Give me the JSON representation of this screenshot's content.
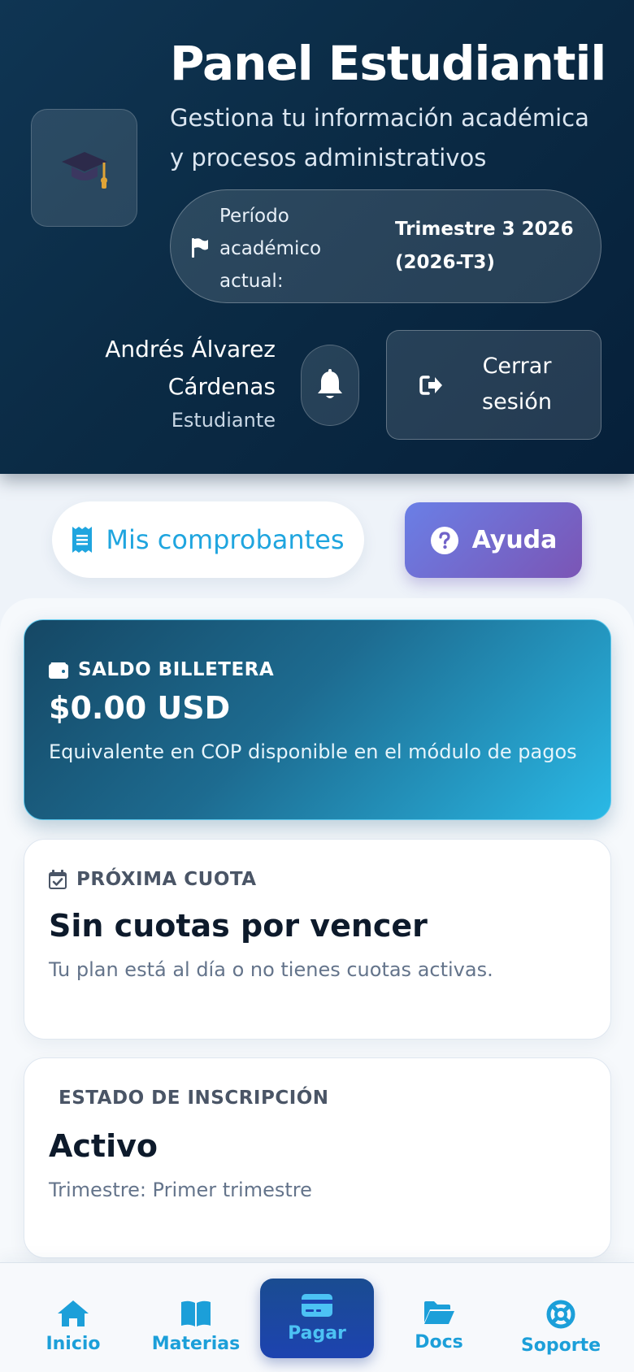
{
  "header": {
    "title": "Panel Estudiantil",
    "subtitle": "Gestiona tu información académica y procesos administrativos",
    "period_label": "Período académico actual:",
    "period_value": "Trimestre 3 2026 (2026-T3)",
    "user_name": "Andrés Álvarez Cárdenas",
    "user_role": "Estudiante",
    "logout_label": "Cerrar sesión"
  },
  "actions": {
    "receipts_label": "Mis comprobantes",
    "help_label": "Ayuda"
  },
  "wallet": {
    "label": "SALDO BILLETERA",
    "amount": "$0.00 USD",
    "note": "Equivalente en COP disponible en el módulo de pagos"
  },
  "next_quota": {
    "label": "PRÓXIMA CUOTA",
    "title": "Sin cuotas por vencer",
    "text": "Tu plan está al día o no tienes cuotas activas."
  },
  "enrollment": {
    "label": "ESTADO DE INSCRIPCIÓN",
    "status": "Activo",
    "text": "Trimestre: Primer trimestre"
  },
  "nav": {
    "items": [
      {
        "label": "Inicio",
        "icon": "home-icon"
      },
      {
        "label": "Materias",
        "icon": "book-icon"
      },
      {
        "label": "Pagar",
        "icon": "credit-card-icon",
        "active": true
      },
      {
        "label": "Docs",
        "icon": "folder-icon"
      },
      {
        "label": "Soporte",
        "icon": "lifebuoy-icon"
      }
    ]
  },
  "colors": {
    "accent": "#1fa5df",
    "header_bg": "#0b2b45",
    "help_gradient": [
      "#6a7fe6",
      "#7b55b5"
    ],
    "nav_active_bg": "#1d43b0"
  }
}
